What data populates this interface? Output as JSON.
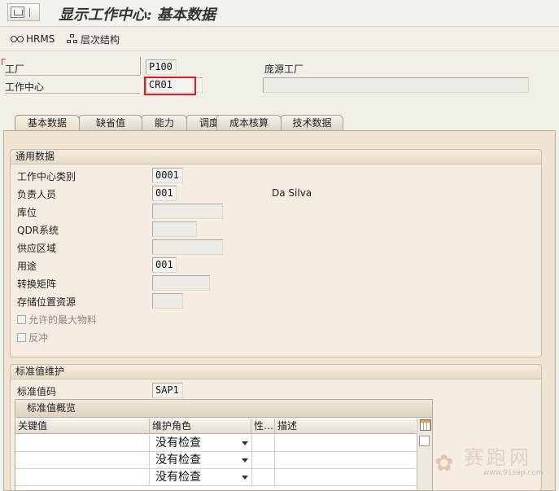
{
  "window": {
    "title": "显示工作中心: 基本数据"
  },
  "toolbar": {
    "hrms_label": "HRMS",
    "hierarchy_label": "层次结构"
  },
  "header": {
    "plant_label": "工厂",
    "plant_value": "P100",
    "plant_desc": "庞源工厂",
    "wc_label": "工作中心",
    "wc_value": "CR01",
    "wc_desc": ""
  },
  "tabs": [
    "基本数据",
    "缺省值",
    "能力",
    "调度",
    "成本核算",
    "技术数据"
  ],
  "general": {
    "title": "通用数据",
    "rows": [
      {
        "label": "工作中心类别",
        "value": "0001"
      },
      {
        "label": "负责人员",
        "value": "001",
        "desc": "Da Silva"
      },
      {
        "label": "库位",
        "value": ""
      },
      {
        "label": "QDR系统",
        "value": ""
      },
      {
        "label": "供应区域",
        "value": ""
      },
      {
        "label": "用途",
        "value": "001"
      },
      {
        "label": "转换矩阵",
        "value": ""
      },
      {
        "label": "存储位置资源",
        "value": ""
      }
    ],
    "checkboxes": [
      {
        "label": "允许的最大物料",
        "checked": false
      },
      {
        "label": "反冲",
        "checked": false
      }
    ]
  },
  "std": {
    "title": "标准值维护",
    "key_label": "标准值码",
    "key_value": "SAP1",
    "overview_title": "标准值概览",
    "columns": [
      "关键值",
      "维护角色",
      "性…",
      "描述"
    ],
    "rows": [
      {
        "role": "没有检查"
      },
      {
        "role": "没有检查"
      },
      {
        "role": "没有检查"
      }
    ]
  },
  "watermark": {
    "brand": "赛跑网",
    "url": "www.91sap.com"
  }
}
